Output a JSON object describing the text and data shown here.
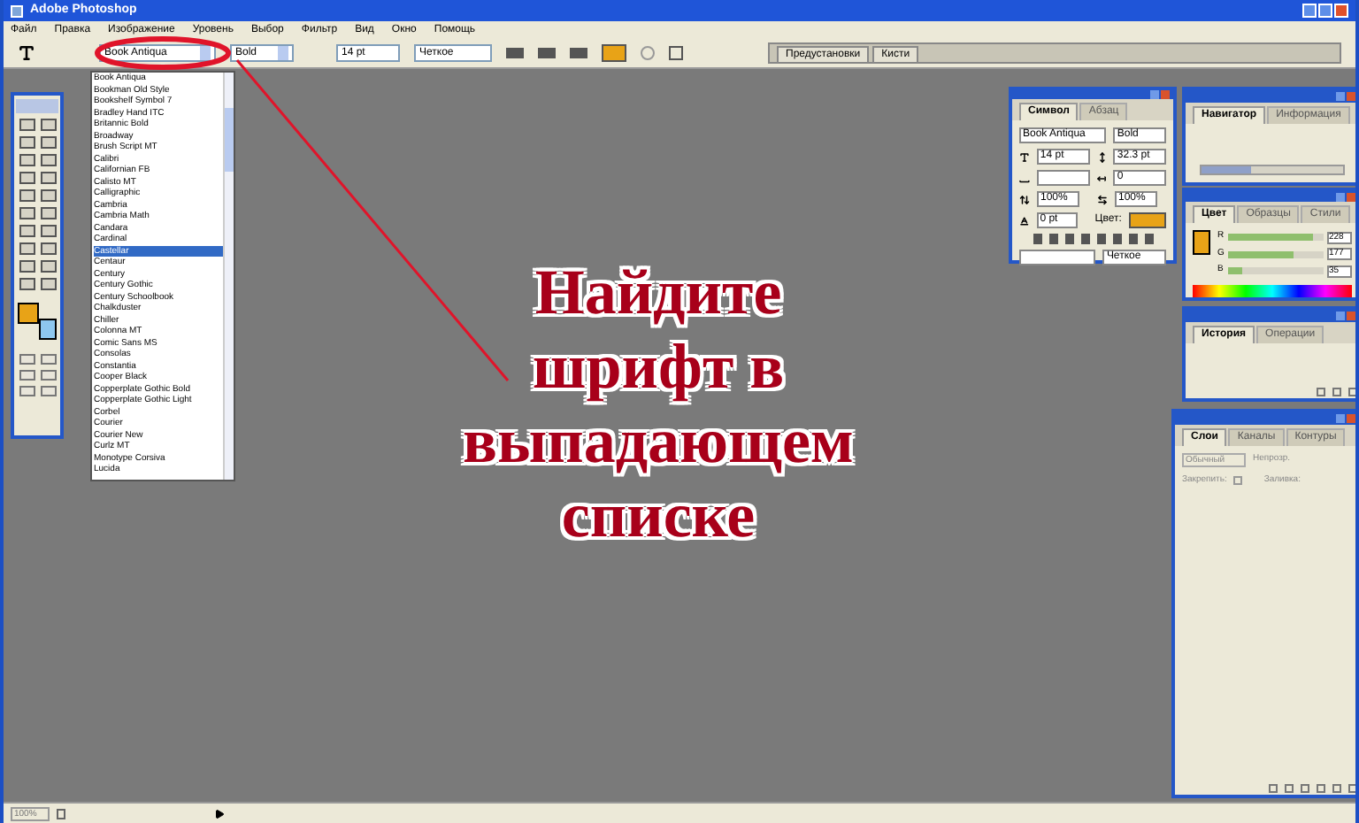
{
  "window": {
    "title": "Adobe Photoshop"
  },
  "menu": [
    "Файл",
    "Правка",
    "Изображение",
    "Уровень",
    "Выбор",
    "Фильтр",
    "Вид",
    "Окно",
    "Помощь"
  ],
  "options_bar": {
    "font": "Book Antiqua",
    "style": "Bold",
    "size": "14 pt",
    "antialias": "Четкое",
    "well_tabs": [
      "Предустановки",
      "Кисти"
    ]
  },
  "font_list": {
    "items": [
      {
        "label": "Book Antiqua",
        "selected": false
      },
      {
        "label": "Bookman Old Style",
        "selected": false
      },
      {
        "label": "Bookshelf Symbol 7",
        "selected": false
      },
      {
        "label": "Bradley Hand ITC",
        "selected": false
      },
      {
        "label": "Britannic Bold",
        "selected": false
      },
      {
        "label": "Broadway",
        "selected": false
      },
      {
        "label": "Brush Script MT",
        "selected": false
      },
      {
        "label": "Calibri",
        "selected": false
      },
      {
        "label": "Californian FB",
        "selected": false
      },
      {
        "label": "Calisto MT",
        "selected": false
      },
      {
        "label": "Calligraphic",
        "selected": false
      },
      {
        "label": "Cambria",
        "selected": false
      },
      {
        "label": "Cambria Math",
        "selected": false
      },
      {
        "label": "Candara",
        "selected": false
      },
      {
        "label": "Cardinal",
        "selected": false
      },
      {
        "label": "Castellar",
        "selected": true
      },
      {
        "label": "Centaur",
        "selected": false
      },
      {
        "label": "Century",
        "selected": false
      },
      {
        "label": "Century Gothic",
        "selected": false
      },
      {
        "label": "Century Schoolbook",
        "selected": false
      },
      {
        "label": "Chalkduster",
        "selected": false
      },
      {
        "label": "Chiller",
        "selected": false
      },
      {
        "label": "Colonna MT",
        "selected": false
      },
      {
        "label": "Comic Sans MS",
        "selected": false
      },
      {
        "label": "Consolas",
        "selected": false
      },
      {
        "label": "Constantia",
        "selected": false
      },
      {
        "label": "Cooper Black",
        "selected": false
      },
      {
        "label": "Copperplate Gothic Bold",
        "selected": false
      },
      {
        "label": "Copperplate Gothic Light",
        "selected": false
      },
      {
        "label": "Corbel",
        "selected": false
      },
      {
        "label": "Courier",
        "selected": false
      },
      {
        "label": "Courier New",
        "selected": false
      },
      {
        "label": "Curlz MT",
        "selected": false
      },
      {
        "label": "Monotype Corsiva",
        "selected": false
      },
      {
        "label": "Lucida",
        "selected": false
      }
    ]
  },
  "character_panel": {
    "tabs": [
      {
        "label": "Символ",
        "selected": true
      },
      {
        "label": "Абзац",
        "selected": false
      }
    ],
    "font": "Book Antiqua",
    "style": "Bold",
    "size": "14 pt",
    "leading": "32.3 pt",
    "tracking": "0",
    "vscale": "100%",
    "hscale": "100%",
    "baseline": "0 pt",
    "color_label": "Цвет:",
    "antialias": "Четкое"
  },
  "navigator_panel": {
    "tabs": [
      {
        "label": "Навигатор",
        "selected": true
      },
      {
        "label": "Информация",
        "selected": false
      }
    ],
    "zoom": {
      "level": 0.35
    }
  },
  "color_panel": {
    "tabs": [
      {
        "label": "Цвет",
        "selected": true
      },
      {
        "label": "Образцы",
        "selected": false
      },
      {
        "label": "Стили",
        "selected": false
      }
    ],
    "channels": [
      {
        "name": "R",
        "value": "228",
        "level": 0.89
      },
      {
        "name": "G",
        "value": "177",
        "level": 0.69
      },
      {
        "name": "B",
        "value": "35",
        "level": 0.14
      }
    ]
  },
  "history_panel": {
    "tabs": [
      {
        "label": "История",
        "selected": true
      },
      {
        "label": "Операции",
        "selected": false
      }
    ]
  },
  "layers_panel": {
    "tabs": [
      {
        "label": "Слои",
        "selected": true
      },
      {
        "label": "Каналы",
        "selected": false
      },
      {
        "label": "Контуры",
        "selected": false
      }
    ],
    "blend": "Обычный",
    "opacity_label": "Непрозр.",
    "lock_label": "Закрепить:",
    "fill_label": "Заливка:"
  },
  "annotation": {
    "lines": [
      "Найдите",
      "шрифт в",
      "выпадающем",
      "списке"
    ]
  },
  "status_bar": {
    "zoom": "100%"
  }
}
